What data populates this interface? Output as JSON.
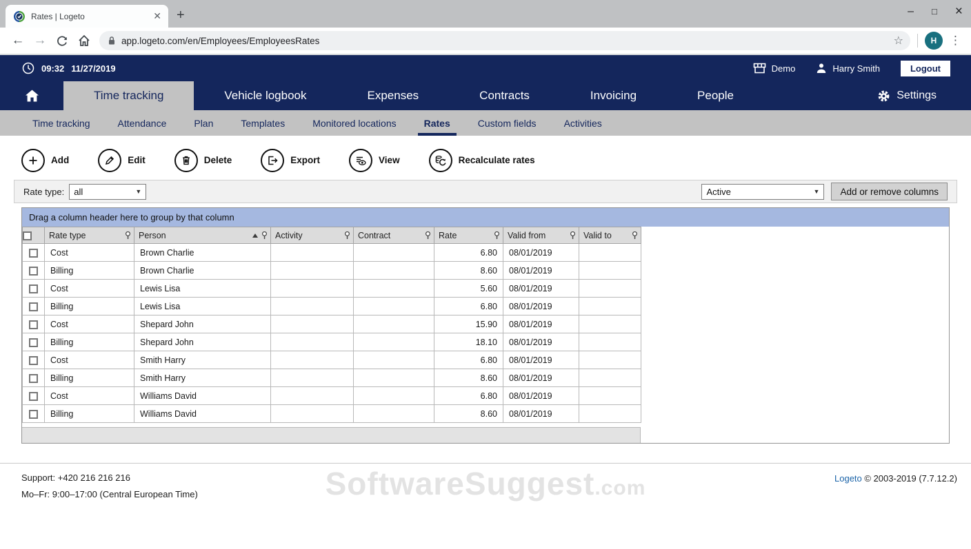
{
  "browser": {
    "tab_title": "Rates | Logeto",
    "url": "app.logeto.com/en/Employees/EmployeesRates",
    "new_tab_label": "+",
    "avatar_initial": "H",
    "window_controls": {
      "minimize": "–",
      "maximize": "□",
      "close": "×"
    }
  },
  "header": {
    "time": "09:32",
    "date": "11/27/2019",
    "company": "Demo",
    "user": "Harry Smith",
    "logout_label": "Logout",
    "settings_label": "Settings"
  },
  "nav": {
    "items": [
      {
        "label": "Time tracking",
        "active": true
      },
      {
        "label": "Vehicle logbook",
        "active": false
      },
      {
        "label": "Expenses",
        "active": false
      },
      {
        "label": "Contracts",
        "active": false
      },
      {
        "label": "Invoicing",
        "active": false
      },
      {
        "label": "People",
        "active": false
      }
    ]
  },
  "subnav": {
    "items": [
      {
        "label": "Time tracking",
        "active": false
      },
      {
        "label": "Attendance",
        "active": false
      },
      {
        "label": "Plan",
        "active": false
      },
      {
        "label": "Templates",
        "active": false
      },
      {
        "label": "Monitored locations",
        "active": false
      },
      {
        "label": "Rates",
        "active": true
      },
      {
        "label": "Custom fields",
        "active": false
      },
      {
        "label": "Activities",
        "active": false
      }
    ]
  },
  "toolbar": {
    "buttons": [
      {
        "label": "Add",
        "icon": "plus-icon"
      },
      {
        "label": "Edit",
        "icon": "pencil-icon"
      },
      {
        "label": "Delete",
        "icon": "trash-icon"
      },
      {
        "label": "Export",
        "icon": "export-icon"
      },
      {
        "label": "View",
        "icon": "view-icon"
      },
      {
        "label": "Recalculate rates",
        "icon": "recalculate-icon"
      }
    ]
  },
  "filters": {
    "rate_type_label": "Rate type:",
    "rate_type_value": "all",
    "status_value": "Active",
    "columns_button": "Add or remove columns"
  },
  "grid": {
    "group_hint": "Drag a column header here to group by that column",
    "columns": [
      "Rate type",
      "Person",
      "Activity",
      "Contract",
      "Rate",
      "Valid from",
      "Valid to"
    ],
    "sorted_column": "Person",
    "sort_direction": "asc",
    "rows": [
      {
        "rate_type": "Cost",
        "person": "Brown Charlie",
        "activity": "",
        "contract": "",
        "rate": "6.80",
        "valid_from": "08/01/2019",
        "valid_to": ""
      },
      {
        "rate_type": "Billing",
        "person": "Brown Charlie",
        "activity": "",
        "contract": "",
        "rate": "8.60",
        "valid_from": "08/01/2019",
        "valid_to": ""
      },
      {
        "rate_type": "Cost",
        "person": "Lewis Lisa",
        "activity": "",
        "contract": "",
        "rate": "5.60",
        "valid_from": "08/01/2019",
        "valid_to": ""
      },
      {
        "rate_type": "Billing",
        "person": "Lewis Lisa",
        "activity": "",
        "contract": "",
        "rate": "6.80",
        "valid_from": "08/01/2019",
        "valid_to": ""
      },
      {
        "rate_type": "Cost",
        "person": "Shepard John",
        "activity": "",
        "contract": "",
        "rate": "15.90",
        "valid_from": "08/01/2019",
        "valid_to": ""
      },
      {
        "rate_type": "Billing",
        "person": "Shepard John",
        "activity": "",
        "contract": "",
        "rate": "18.10",
        "valid_from": "08/01/2019",
        "valid_to": ""
      },
      {
        "rate_type": "Cost",
        "person": "Smith Harry",
        "activity": "",
        "contract": "",
        "rate": "6.80",
        "valid_from": "08/01/2019",
        "valid_to": ""
      },
      {
        "rate_type": "Billing",
        "person": "Smith Harry",
        "activity": "",
        "contract": "",
        "rate": "8.60",
        "valid_from": "08/01/2019",
        "valid_to": ""
      },
      {
        "rate_type": "Cost",
        "person": "Williams David",
        "activity": "",
        "contract": "",
        "rate": "6.80",
        "valid_from": "08/01/2019",
        "valid_to": ""
      },
      {
        "rate_type": "Billing",
        "person": "Williams David",
        "activity": "",
        "contract": "",
        "rate": "8.60",
        "valid_from": "08/01/2019",
        "valid_to": ""
      }
    ]
  },
  "footer": {
    "support_line1": "Support: +420 216 216 216",
    "support_line2": "Mo–Fr: 9:00–17:00 (Central European Time)",
    "watermark_main": "SoftwareSuggest",
    "watermark_suffix": ".com",
    "copyright_link": "Logeto",
    "copyright_rest": " © 2003-2019 (7.7.12.2)"
  },
  "colors": {
    "navy": "#14265c",
    "nav_gray": "#c2c2c2",
    "group_bar_blue": "#a5b8e0",
    "grid_header_gray": "#dcdcdc",
    "link_blue": "#1a63a8",
    "avatar_teal": "#19707f"
  }
}
